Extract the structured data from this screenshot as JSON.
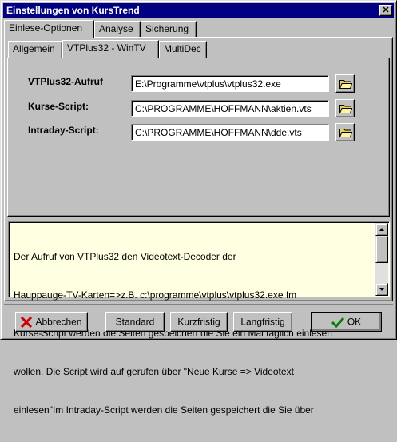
{
  "window": {
    "title": "Einstellungen von KursTrend",
    "close_glyph": "✕"
  },
  "outer_tabs": [
    {
      "label": "Einlese-Optionen",
      "active": true
    },
    {
      "label": "Analyse",
      "active": false
    },
    {
      "label": "Sicherung",
      "active": false
    }
  ],
  "inner_tabs": [
    {
      "label": "Allgemein",
      "active": false
    },
    {
      "label": "VTPlus32 - WinTV",
      "active": true
    },
    {
      "label": "MultiDec",
      "active": false
    }
  ],
  "fields": [
    {
      "label": "VTPlus32-Aufruf",
      "value": "E:\\Programme\\vtplus\\vtplus32.exe",
      "browse_icon": "folder-icon"
    },
    {
      "label": "Kurse-Script:",
      "value": "C:\\PROGRAMME\\HOFFMANN\\aktien.vts",
      "browse_icon": "folder-icon"
    },
    {
      "label": "Intraday-Script:",
      "value": "C:\\PROGRAMME\\HOFFMANN\\dde.vts",
      "browse_icon": "folder-icon"
    }
  ],
  "help_text": {
    "lines": [
      "Der Aufruf von VTPlus32 den Videotext-Decoder der",
      "Hauppauge-TV-Karten=>z.B. c:\\programme\\vtplus\\vtplus32.exe Im",
      "Kurse-Script werden die Seiten gespeichert die Sie ein Mal täglich einlesen",
      "wollen. Die Script wird auf gerufen über \"Neue Kurse => Videotext",
      "einlesen\"Im Intraday-Script werden die Seiten gespeichert die Sie über"
    ],
    "background": "#ffffe1"
  },
  "buttons": {
    "cancel": {
      "label": "Abbrechen",
      "icon": "red-x-icon",
      "accent": "#cc0000"
    },
    "standard": {
      "label": "Standard"
    },
    "short_term": {
      "label": "Kurzfristig"
    },
    "long_term": {
      "label": "Langfristig"
    },
    "ok": {
      "label": "OK",
      "icon": "green-check-icon",
      "accent": "#008000"
    }
  },
  "colors": {
    "titlebar": "#000080",
    "face": "#c0c0c0",
    "folder": "#e8d060"
  }
}
